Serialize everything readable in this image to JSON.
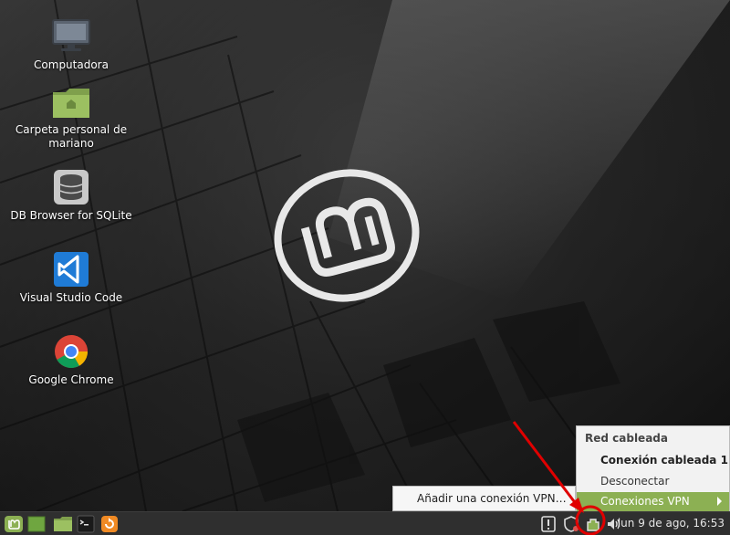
{
  "desktop": {
    "icons": [
      {
        "label": "Computadora",
        "icon": "computer-icon"
      },
      {
        "label": "Carpeta personal de mariano",
        "icon": "home-folder-icon"
      },
      {
        "label": "DB Browser for SQLite",
        "icon": "database-icon"
      },
      {
        "label": "Visual Studio Code",
        "icon": "vscode-icon"
      },
      {
        "label": "Google Chrome",
        "icon": "chrome-icon"
      }
    ]
  },
  "network_menu": {
    "header": "Red cableada",
    "connection": "Conexión cableada 1",
    "disconnect": "Desconectar",
    "vpn": "Conexiones VPN"
  },
  "vpn_submenu": {
    "add_vpn": "Añadir una conexión VPN…"
  },
  "panel": {
    "clock": "lun  9 de ago, 16:53",
    "launchers": [
      "menu-icon",
      "show-desktop-icon",
      "file-manager-icon",
      "terminal-icon",
      "update-manager-icon"
    ],
    "tray": [
      "notifications-icon",
      "shield-icon",
      "network-icon",
      "volume-icon"
    ]
  },
  "colors": {
    "accent": "#8cb053",
    "annotation": "#e00000",
    "panel": "#2f2f2f"
  }
}
